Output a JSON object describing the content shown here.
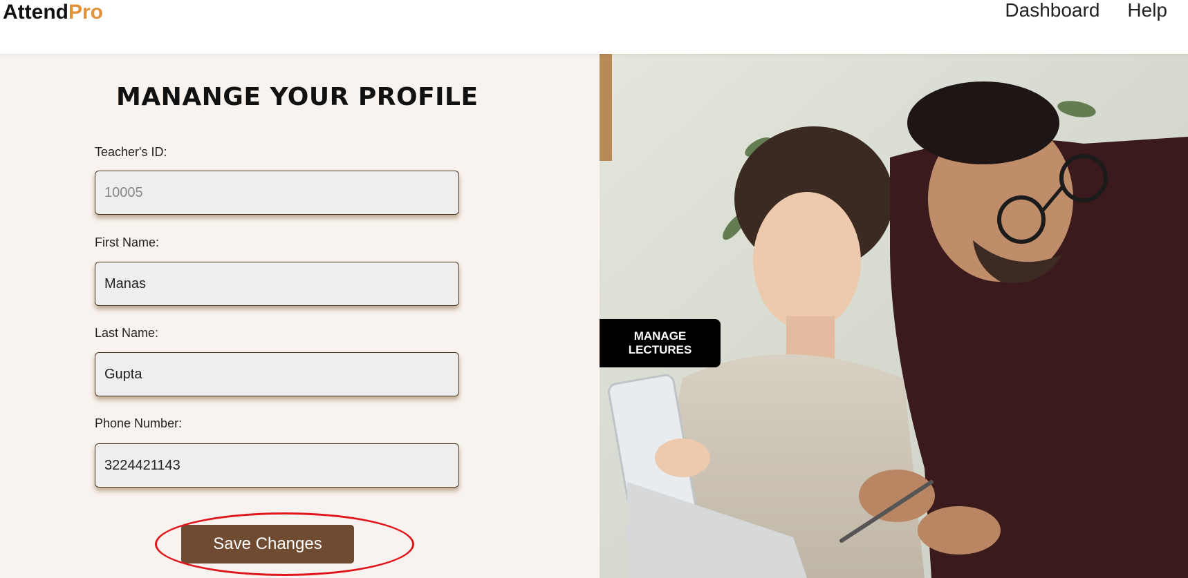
{
  "header": {
    "logo_main": "Attend",
    "logo_accent": "Pro",
    "nav": [
      "Dashboard",
      "Help"
    ]
  },
  "form": {
    "title": "MANANGE YOUR PROFILE",
    "fields": [
      {
        "label": "Teacher's ID:",
        "value": "10005",
        "readonly": true
      },
      {
        "label": "First Name:",
        "value": "Manas"
      },
      {
        "label": "Last Name:",
        "value": "Gupta"
      },
      {
        "label": "Phone Number:",
        "value": "3224421143"
      }
    ],
    "save_label": "Save Changes"
  },
  "side": {
    "manage_lectures": "MANAGE LECTURES"
  },
  "colors": {
    "accent": "#e0913a",
    "button": "#6f4b32",
    "panel_bg": "#f8f3ee",
    "highlight": "#e0161c"
  }
}
